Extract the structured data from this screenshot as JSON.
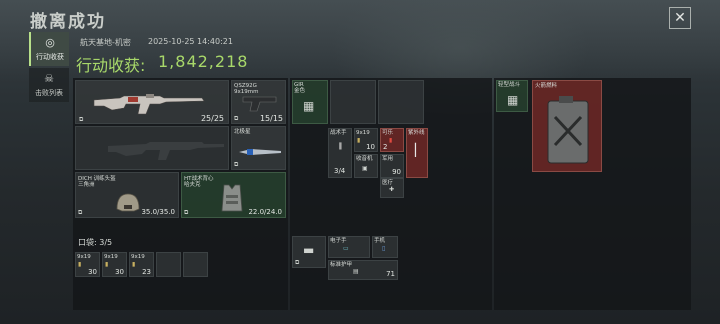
{
  "header": {
    "title": "撤离成功",
    "close_icon": "close-icon"
  },
  "tabs": [
    {
      "label": "行动收获",
      "icon": "target-icon",
      "active": true
    },
    {
      "label": "击败列表",
      "icon": "skull-icon",
      "active": false
    }
  ],
  "raid": {
    "location": "航天基地-机密",
    "timestamp": "2025-10-25 14:40:21",
    "harvest_label": "行动收获:",
    "harvest_value": "1,842,218"
  },
  "equipment": {
    "primary_weapon": {
      "count": "25/25"
    },
    "secondary_weapon": {
      "name": "QSZ92G",
      "ammo": "9x19mm",
      "count": "15/15"
    },
    "knife": {
      "name": "北极星"
    },
    "helmet": {
      "name": "DICH 训练头盔",
      "subname": "三角洲",
      "count": "35.0/35.0"
    },
    "armor": {
      "name": "HT战术背心",
      "subname": "哈夫克",
      "count": "22.0/24.0"
    }
  },
  "pocket": {
    "title": "口袋: 3/5",
    "items": [
      {
        "label": "9x19",
        "count": "30"
      },
      {
        "label": "9x19",
        "count": "30"
      },
      {
        "label": "9x19",
        "count": "23"
      }
    ]
  },
  "backpack": {
    "items": [
      {
        "label": "GIR",
        "sub": "金色",
        "count": ""
      },
      {
        "label": "战术手",
        "count": "3/4"
      },
      {
        "label": "9x19",
        "count": "10"
      },
      {
        "label": "收音机",
        "count": ""
      },
      {
        "label": "可乐",
        "count": "2"
      },
      {
        "label": "紫外线",
        "count": ""
      },
      {
        "label": "军用",
        "count": "90"
      },
      {
        "label": "医疗",
        "count": ""
      },
      {
        "label": "电子手",
        "count": ""
      },
      {
        "label": "手机",
        "count": ""
      },
      {
        "label": "标准护甲",
        "count": "71"
      }
    ]
  },
  "stash": {
    "items": [
      {
        "label": "轻型战斗",
        "count": ""
      },
      {
        "label": "火箭燃料",
        "count": ""
      }
    ]
  }
}
